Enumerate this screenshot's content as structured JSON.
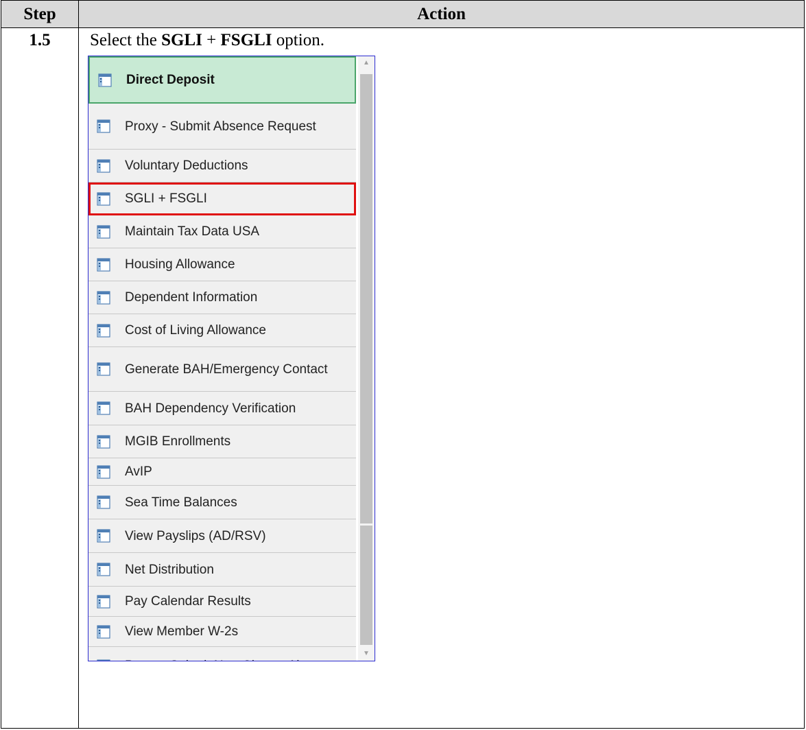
{
  "table": {
    "header_step": "Step",
    "header_action": "Action",
    "step_number": "1.5",
    "instruction": {
      "prefix": "Select the ",
      "bold1": "SGLI",
      "mid": " + ",
      "bold2": "FSGLI",
      "suffix": " option."
    }
  },
  "menu": {
    "icon": "page-icon",
    "items": [
      {
        "label": "Direct Deposit",
        "state": "active"
      },
      {
        "label": "Proxy - Submit Absence Request"
      },
      {
        "label": "Voluntary Deductions"
      },
      {
        "label": "SGLI + FSGLI",
        "state": "highlighted"
      },
      {
        "label": "Maintain Tax Data USA"
      },
      {
        "label": "Housing Allowance"
      },
      {
        "label": "Dependent Information"
      },
      {
        "label": "Cost of Living Allowance"
      },
      {
        "label": "Generate BAH/Emergency Contact"
      },
      {
        "label": "BAH Dependency Verification"
      },
      {
        "label": "MGIB Enrollments"
      },
      {
        "label": "AvIP"
      },
      {
        "label": "Sea Time Balances"
      },
      {
        "label": "View Payslips (AD/RSV)"
      },
      {
        "label": "Net Distribution"
      },
      {
        "label": "Pay Calendar Results"
      },
      {
        "label": "View Member W-2s"
      },
      {
        "label": "Proxy - Submit Non-Charge Abs"
      }
    ]
  },
  "colors": {
    "active_bg": "#c8ead4",
    "active_border": "#4aa56a",
    "highlight_border": "#e01010",
    "item_bg": "#f0f0f0",
    "frame_border": "#2b2bd0"
  }
}
